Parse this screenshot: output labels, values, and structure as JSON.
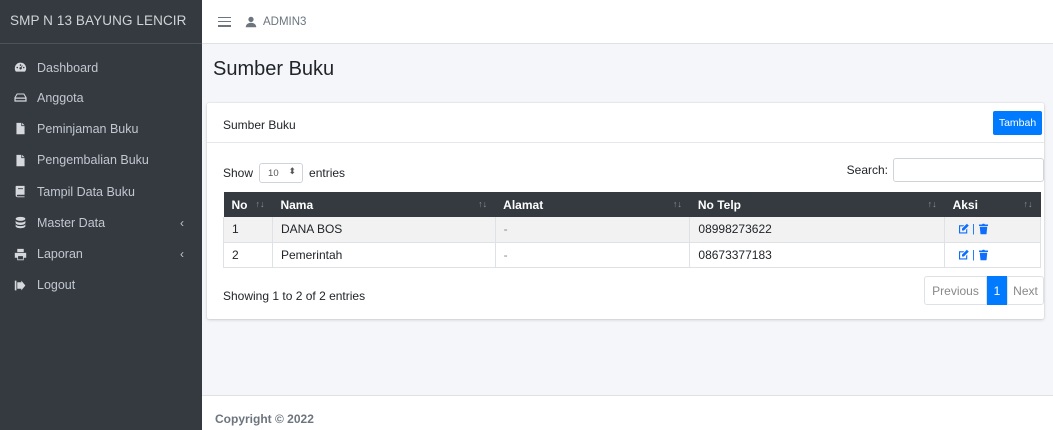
{
  "brand": "SMP N 13 BAYUNG LENCIR",
  "sidebar": {
    "items": [
      {
        "label": "Dashboard",
        "icon": "tachometer-icon"
      },
      {
        "label": "Anggota",
        "icon": "hdd-icon"
      },
      {
        "label": "Peminjaman Buku",
        "icon": "file-icon"
      },
      {
        "label": "Pengembalian Buku",
        "icon": "file-icon"
      },
      {
        "label": "Tampil Data Buku",
        "icon": "book-icon"
      },
      {
        "label": "Master Data",
        "icon": "database-icon",
        "chevron": "‹"
      },
      {
        "label": "Laporan",
        "icon": "print-icon",
        "chevron": "‹"
      },
      {
        "label": "Logout",
        "icon": "sign-out-icon"
      }
    ]
  },
  "topbar": {
    "user": "ADMIN3"
  },
  "page": {
    "title": "Sumber Buku"
  },
  "card": {
    "title": "Sumber Buku",
    "add_button": "Tambah",
    "show_label": "Show",
    "entries_value": "10",
    "entries_label": "entries",
    "search_label": "Search:",
    "search_value": ""
  },
  "table": {
    "columns": [
      "No",
      "Nama",
      "Alamat",
      "No Telp",
      "Aksi"
    ],
    "rows": [
      {
        "no": "1",
        "nama": "DANA BOS",
        "alamat": "-",
        "telp": "08998273622"
      },
      {
        "no": "2",
        "nama": "Pemerintah",
        "alamat": "-",
        "telp": "08673377183"
      }
    ]
  },
  "info": "Showing 1 to 2 of 2 entries",
  "pagination": {
    "previous": "Previous",
    "page": "1",
    "next": "Next"
  },
  "footer": "Copyright © 2022",
  "colors": {
    "sidebar": "#343a40",
    "primary": "#007bff",
    "table_header": "#343a40"
  }
}
